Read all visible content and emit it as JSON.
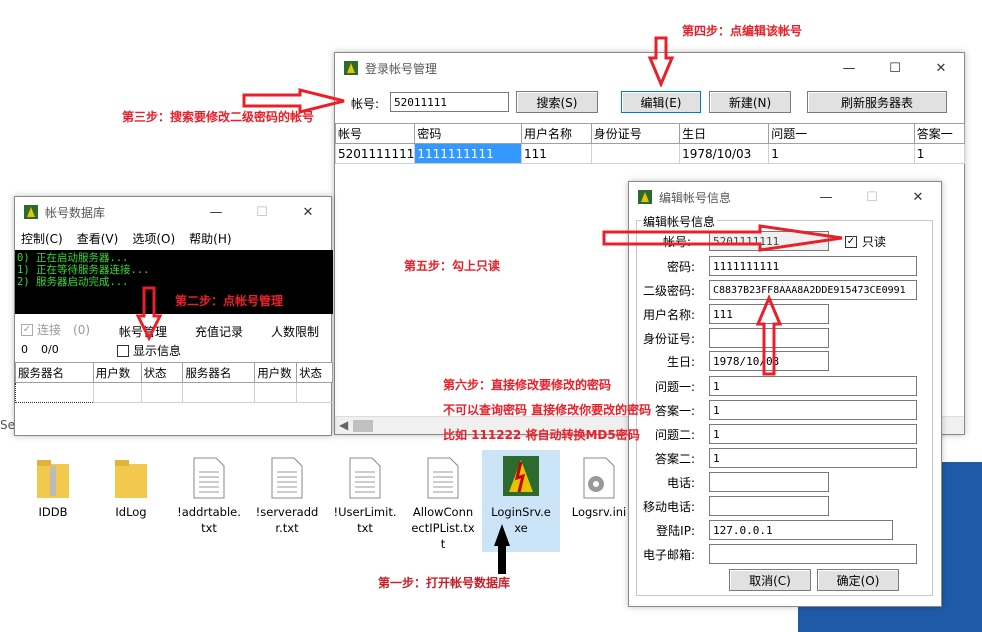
{
  "accounts_window": {
    "title": "登录帐号管理",
    "account_label": "帐号:",
    "account_value": "52011111",
    "search_btn": "搜索(S)",
    "edit_btn": "编辑(E)",
    "new_btn": "新建(N)",
    "refresh_btn": "刷新服务器表",
    "columns": [
      "帐号",
      "密码",
      "用户名称",
      "身份证号",
      "生日",
      "问题一",
      "答案一"
    ],
    "rows": [
      [
        "5201111111",
        "1111111111",
        "111",
        "",
        "1978/10/03",
        "1",
        "1"
      ]
    ]
  },
  "db_window": {
    "title": "帐号数据库",
    "menu": [
      "控制(C)",
      "查看(V)",
      "选项(O)",
      "帮助(H)"
    ],
    "console_lines": [
      "0) 正在启动服务器...",
      "1) 正在等待服务器连接...",
      "2) 服务器启动完成..."
    ],
    "connect_label": "连接",
    "connect_count": "(0)",
    "tab_accounts": "帐号管理",
    "tab_recharge": "充值记录",
    "tab_limit": "人数限制",
    "counter_a": "0",
    "counter_b": "0/0",
    "show_info": "显示信息",
    "columns": [
      "服务器名",
      "用户数",
      "状态",
      "服务器名",
      "用户数",
      "状态"
    ]
  },
  "edit_window": {
    "title": "编辑帐号信息",
    "group_title": "编辑帐号信息",
    "readonly_label": "只读",
    "fields": {
      "account": {
        "label": "帐号:",
        "value": "5201111111"
      },
      "password": {
        "label": "密码:",
        "value": "1111111111"
      },
      "password2": {
        "label": "二级密码:",
        "value": "C8837B23FF8AAA8A2DDE915473CE0991"
      },
      "username": {
        "label": "用户名称:",
        "value": "111"
      },
      "idcard": {
        "label": "身份证号:",
        "value": ""
      },
      "birthday": {
        "label": "生日:",
        "value": "1978/10/03"
      },
      "q1": {
        "label": "问题一:",
        "value": "1"
      },
      "a1": {
        "label": "答案一:",
        "value": "1"
      },
      "q2": {
        "label": "问题二:",
        "value": "1"
      },
      "a2": {
        "label": "答案二:",
        "value": "1"
      },
      "phone": {
        "label": "电话:",
        "value": ""
      },
      "mobile": {
        "label": "移动电话:",
        "value": ""
      },
      "login_ip": {
        "label": "登陆IP:",
        "value": "127.0.0.1"
      },
      "email": {
        "label": "电子邮箱:",
        "value": ""
      }
    },
    "cancel_btn": "取消(C)",
    "ok_btn": "确定(O)"
  },
  "annotations": {
    "step1": "第一步：打开帐号数据库",
    "step2": "第二步：点帐号管理",
    "step3": "第三步：搜索要修改二级密码的帐号",
    "step4": "第四步：点编辑该帐号",
    "step5": "第五步：勾上只读",
    "step6_line1": "第六步：直接修改要修改的密码",
    "step6_line2": "不可以查询密码 直接修改你要改的密码",
    "step6_line3": "比如 111222 将自动转换MD5密码"
  },
  "files": [
    {
      "name": "IDDB",
      "icon": "folder-zip-icon"
    },
    {
      "name": "IdLog",
      "icon": "folder-icon"
    },
    {
      "name": "!addrtable.txt",
      "icon": "text-file-icon"
    },
    {
      "name": "!serveraddr.txt",
      "icon": "text-file-icon"
    },
    {
      "name": "!UserLimit.txt",
      "icon": "text-file-icon"
    },
    {
      "name": "AllowConnectIPList.txt",
      "icon": "text-file-icon"
    },
    {
      "name": "LoginSrv.exe",
      "icon": "app-icon"
    },
    {
      "name": "Logsrv.ini",
      "icon": "settings-file-icon"
    }
  ],
  "colors": {
    "annotation": "#e8202a",
    "selection": "#3399ff",
    "console_bg": "#000000",
    "console_fg": "#33dd33"
  }
}
